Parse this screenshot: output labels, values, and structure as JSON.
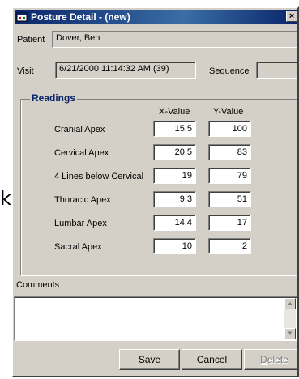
{
  "window": {
    "title": "Posture Detail - (new)",
    "close_glyph": "×"
  },
  "patient": {
    "label": "Patient",
    "value": "Dover, Ben"
  },
  "visit": {
    "label": "Visit",
    "value": "6/21/2000 11:14:32 AM (39)"
  },
  "sequence": {
    "label": "Sequence",
    "value": ""
  },
  "readings": {
    "title": "Readings",
    "x_header": "X-Value",
    "y_header": "Y-Value",
    "rows": [
      {
        "label": "Cranial Apex",
        "x": "15.5",
        "y": "100"
      },
      {
        "label": "Cervical Apex",
        "x": "20.5",
        "y": "83"
      },
      {
        "label": "4 Lines below Cervical",
        "x": "19",
        "y": "79"
      },
      {
        "label": "Thoracic Apex",
        "x": "9.3",
        "y": "51"
      },
      {
        "label": "Lumbar Apex",
        "x": "14.4",
        "y": "17"
      },
      {
        "label": "Sacral Apex",
        "x": "10",
        "y": "2"
      }
    ]
  },
  "comments": {
    "label": "Comments",
    "value": ""
  },
  "buttons": {
    "save": "Save",
    "cancel": "Cancel",
    "delete": "Delete"
  },
  "background_fragment": "k",
  "icons": {
    "app": "app-window-icon",
    "scroll_up": "scroll-up-icon",
    "scroll_down": "scroll-down-icon"
  },
  "colors": {
    "titlebar": "#0a246a",
    "face": "#d4d0c8",
    "group_title": "#0a246a"
  }
}
